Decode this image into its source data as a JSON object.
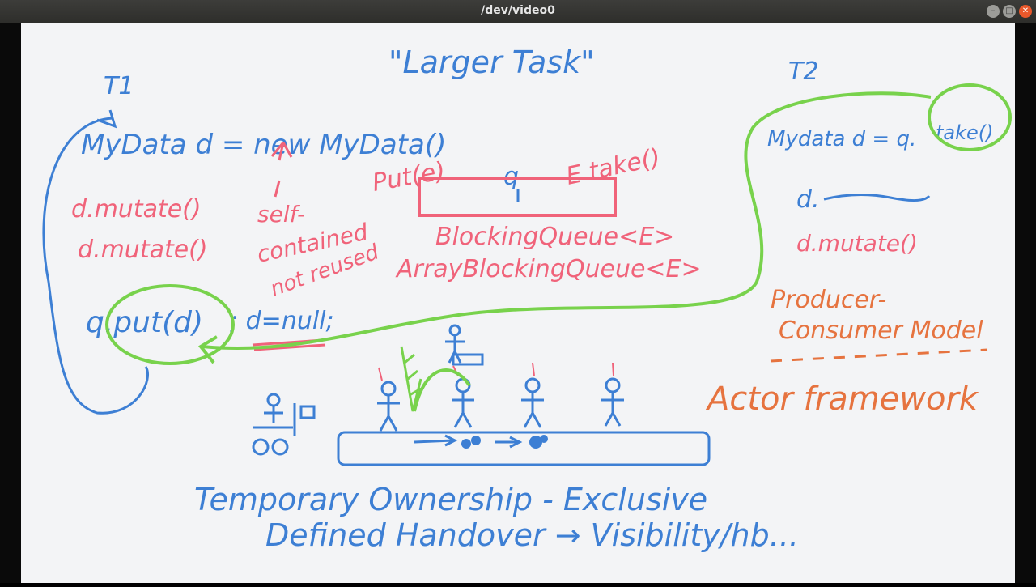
{
  "window": {
    "title": "/dev/video0",
    "minimize_icon": "minimize-icon",
    "maximize_icon": "maximize-icon",
    "close_icon": "close-icon"
  },
  "colors": {
    "blue": "#3d7fd4",
    "red": "#f0637a",
    "green": "#78d24c",
    "orange": "#e6733f",
    "board": "#f3f4f6"
  },
  "board": {
    "heading": "\"Larger Task\"",
    "t1": {
      "label": "T1",
      "decl": "MyData d = new MyData()",
      "mutate1": "d.mutate()",
      "mutate2": "d.mutate()",
      "put": "q.put(d)",
      "nullify": "; d=null;"
    },
    "notes": {
      "self": "self-",
      "contained": "contained",
      "not_reused": "not reused",
      "put_e": "Put(e)",
      "q": "q",
      "take_e": "E take()"
    },
    "queue": {
      "type1": "BlockingQueue<E>",
      "type2": "ArrayBlockingQueue<E>"
    },
    "t2": {
      "label": "T2",
      "decl_prefix": "Mydata d = q.",
      "take": "take()",
      "d_line": "d.",
      "mutate": "d.mutate()"
    },
    "patterns": {
      "producer": "Producer-",
      "consumer": "Consumer Model",
      "actor": "Actor framework"
    },
    "footer": {
      "line1": "Temporary Ownership - Exclusive",
      "line2": "Defined Handover → Visibility/hb..."
    }
  }
}
